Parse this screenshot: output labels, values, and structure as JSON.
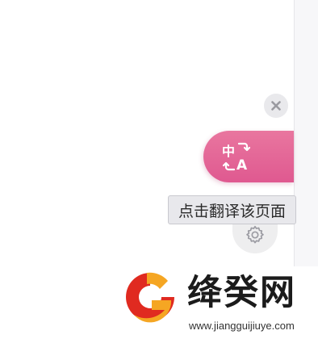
{
  "translate_widget": {
    "tooltip_text": "点击翻译该页面",
    "accent_color": "#e06694",
    "icons": {
      "close": "close-icon",
      "translate": "translate-zh-a-icon",
      "settings": "gear-icon"
    }
  },
  "watermark": {
    "title": "绛癸网",
    "url": "www.jiangguijiuye.com"
  }
}
